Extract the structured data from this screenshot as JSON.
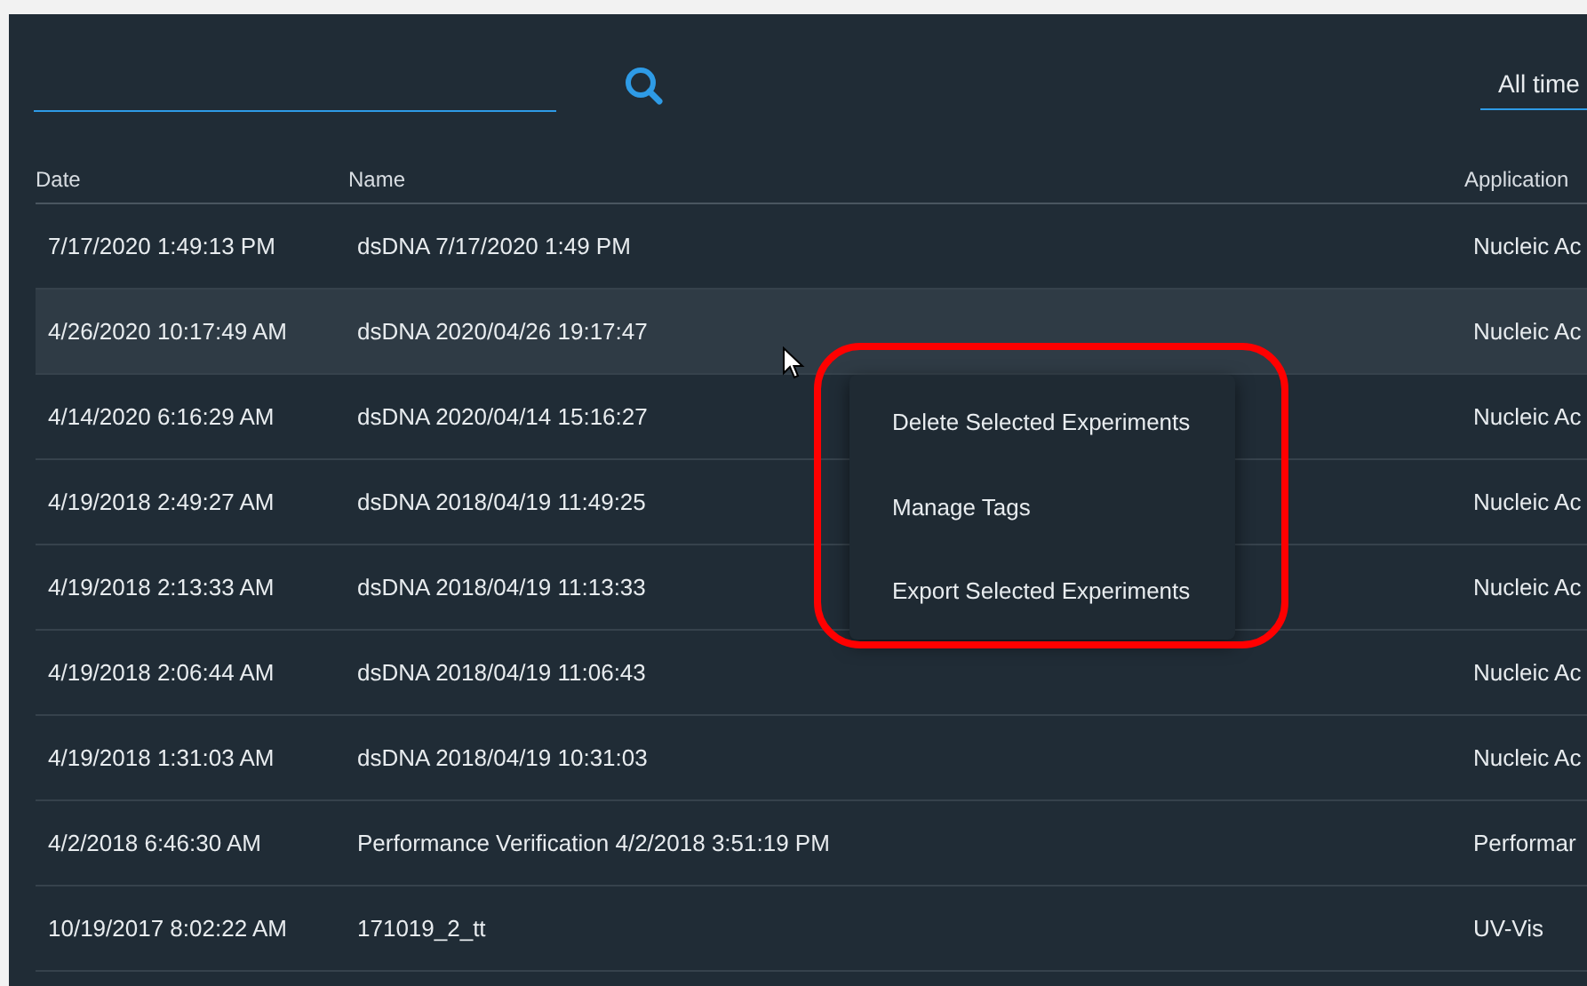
{
  "time_filter": {
    "value": "All time"
  },
  "table": {
    "columns": [
      "Date",
      "Name",
      "Application"
    ],
    "rows": [
      {
        "date": "7/17/2020 1:49:13 PM",
        "name": "dsDNA 7/17/2020 1:49 PM",
        "application": "Nucleic Ac",
        "selected": false
      },
      {
        "date": "4/26/2020 10:17:49 AM",
        "name": "dsDNA 2020/04/26 19:17:47",
        "application": "Nucleic Ac",
        "selected": true
      },
      {
        "date": "4/14/2020 6:16:29 AM",
        "name": "dsDNA 2020/04/14 15:16:27",
        "application": "Nucleic Ac",
        "selected": false
      },
      {
        "date": "4/19/2018 2:49:27 AM",
        "name": "dsDNA 2018/04/19 11:49:25",
        "application": "Nucleic Ac",
        "selected": false
      },
      {
        "date": "4/19/2018 2:13:33 AM",
        "name": "dsDNA 2018/04/19 11:13:33",
        "application": "Nucleic Ac",
        "selected": false
      },
      {
        "date": "4/19/2018 2:06:44 AM",
        "name": "dsDNA 2018/04/19 11:06:43",
        "application": "Nucleic Ac",
        "selected": false
      },
      {
        "date": "4/19/2018 1:31:03 AM",
        "name": "dsDNA 2018/04/19 10:31:03",
        "application": "Nucleic Ac",
        "selected": false
      },
      {
        "date": "4/2/2018 6:46:30 AM",
        "name": "Performance Verification 4/2/2018 3:51:19 PM",
        "application": "Performar",
        "selected": false
      },
      {
        "date": "10/19/2017 8:02:22 AM",
        "name": "171019_2_tt",
        "application": "UV-Vis",
        "selected": false
      }
    ]
  },
  "context_menu": {
    "items": [
      "Delete Selected Experiments",
      "Manage Tags",
      "Export Selected Experiments"
    ]
  }
}
